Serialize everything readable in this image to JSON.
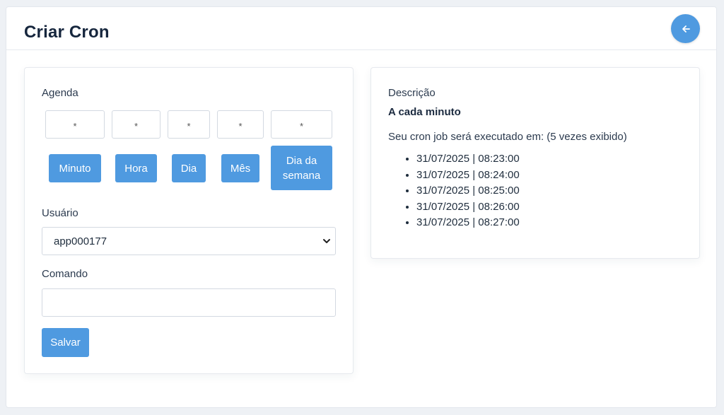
{
  "header": {
    "title": "Criar Cron",
    "back_icon": "arrow-left-icon",
    "accent": "#4f9ae0"
  },
  "form": {
    "schedule_label": "Agenda",
    "cron_fields": [
      {
        "value": "*",
        "label": "Minuto"
      },
      {
        "value": "*",
        "label": "Hora"
      },
      {
        "value": "*",
        "label": "Dia"
      },
      {
        "value": "*",
        "label": "Mês"
      },
      {
        "value": "*",
        "label": "Dia da semana"
      }
    ],
    "user_label": "Usuário",
    "user_selected": "app000177",
    "command_label": "Comando",
    "command_value": "",
    "save_label": "Salvar"
  },
  "description": {
    "label": "Descrição",
    "summary": "A cada minuto",
    "runs_text": "Seu cron job será executado em: (5 vezes exibido)",
    "runs": [
      "31/07/2025 | 08:23:00",
      "31/07/2025 | 08:24:00",
      "31/07/2025 | 08:25:00",
      "31/07/2025 | 08:26:00",
      "31/07/2025 | 08:27:00"
    ]
  }
}
